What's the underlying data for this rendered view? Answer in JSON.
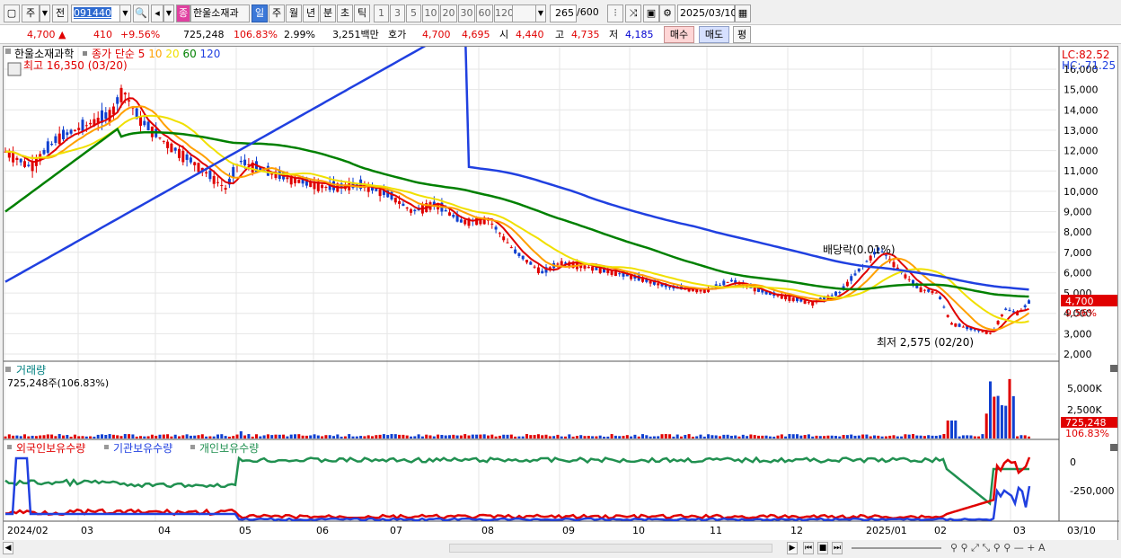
{
  "toolbar": {
    "period": "주",
    "prev_label": "전",
    "code": "091440",
    "stock_name": "한울소재과",
    "stock_badge": "종",
    "intervals": [
      "일",
      "주",
      "월",
      "년",
      "분",
      "초",
      "틱"
    ],
    "active_interval": "일",
    "numbers": [
      "1",
      "3",
      "5",
      "10",
      "20",
      "30",
      "60",
      "120"
    ],
    "count": "265",
    "count_total": "/600",
    "date": "2025/03/10"
  },
  "quote": {
    "price": "4,700",
    "change": "410",
    "change_pct": "+9.56%",
    "volume": "725,248",
    "volume_ratio": "106.83%",
    "turnover": "2.99%",
    "amount": "3,251백만",
    "bid_label": "호가",
    "bid1": "4,700",
    "bid2": "4,695",
    "open_label": "시",
    "open": "4,440",
    "high_label": "고",
    "high": "4,735",
    "low_label": "저",
    "low": "4,185",
    "buy_label": "매수",
    "sell_label": "매도",
    "avg_label": "평"
  },
  "price_panel": {
    "title": "한울소재과학",
    "ma_label": "종가 단순",
    "ma_periods": [
      "5",
      "10",
      "20",
      "60",
      "120"
    ],
    "ma_colors": [
      "#e00000",
      "#ffa000",
      "#f0e000",
      "#008000",
      "#2040e0"
    ],
    "lc": "LC:82.52",
    "hc": "HC:-71.25",
    "high_note": "최고 16,350 (03/20)",
    "low_note": "최저 2,575 (02/20)",
    "dividend_note": "배당락(0.01%)",
    "current_price_tag": "4,700",
    "current_pct_tag": "9.56%",
    "y_labels": [
      "16,000",
      "15,000",
      "14,000",
      "13,000",
      "12,000",
      "11,000",
      "10,000",
      "9,000",
      "8,000",
      "7,000",
      "6,000",
      "5,000",
      "4,000",
      "3,000",
      "2,000"
    ]
  },
  "volume_panel": {
    "title": "거래량",
    "subtitle": "725,248주(106.83%)",
    "y_labels": [
      "5,000K",
      "2,500K"
    ],
    "tag_volume": "725,248",
    "tag_pct": "106.83%"
  },
  "holdings_panel": {
    "legend": [
      "외국인보유수량",
      "기관보유수량",
      "개인보유수량"
    ],
    "colors": [
      "#e00000",
      "#2040e0",
      "#209050"
    ],
    "y_labels": [
      "0",
      "-250,000"
    ]
  },
  "x_axis": {
    "labels": [
      "2024/02",
      "03",
      "04",
      "05",
      "06",
      "07",
      "08",
      "09",
      "10",
      "11",
      "12",
      "2025/01",
      "02",
      "03"
    ],
    "right_label": "03/10"
  }
}
